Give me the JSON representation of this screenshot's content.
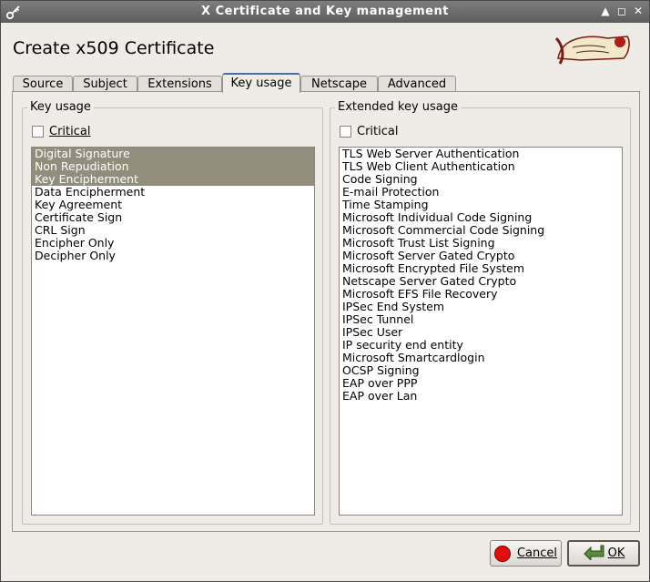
{
  "window": {
    "title": "X Certificate and Key management",
    "app_icon": "key-icon"
  },
  "page_title": "Create x509 Certificate",
  "tabs": [
    {
      "label": "Source"
    },
    {
      "label": "Subject"
    },
    {
      "label": "Extensions"
    },
    {
      "label": "Key usage",
      "active": true
    },
    {
      "label": "Netscape"
    },
    {
      "label": "Advanced"
    }
  ],
  "key_usage": {
    "title": "Key usage",
    "critical_label": "Critical",
    "critical_checked": false,
    "items": [
      {
        "label": "Digital Signature",
        "selected": true
      },
      {
        "label": "Non Repudiation",
        "selected": true
      },
      {
        "label": "Key Encipherment",
        "selected": true
      },
      {
        "label": "Data Encipherment",
        "selected": false
      },
      {
        "label": "Key Agreement",
        "selected": false
      },
      {
        "label": "Certificate Sign",
        "selected": false
      },
      {
        "label": "CRL Sign",
        "selected": false
      },
      {
        "label": "Encipher Only",
        "selected": false
      },
      {
        "label": "Decipher Only",
        "selected": false
      }
    ]
  },
  "extended_key_usage": {
    "title": "Extended key usage",
    "critical_label": "Critical",
    "critical_checked": false,
    "items": [
      "TLS Web Server Authentication",
      "TLS Web Client Authentication",
      "Code Signing",
      "E-mail Protection",
      "Time Stamping",
      "Microsoft Individual Code Signing",
      "Microsoft Commercial Code Signing",
      "Microsoft Trust List Signing",
      "Microsoft Server Gated Crypto",
      "Microsoft Encrypted File System",
      "Netscape Server Gated Crypto",
      "Microsoft EFS File Recovery",
      "IPSec End System",
      "IPSec Tunnel",
      "IPSec User",
      "IP security end entity",
      "Microsoft Smartcardlogin",
      "OCSP Signing",
      "EAP over PPP",
      "EAP over Lan"
    ]
  },
  "buttons": {
    "cancel_label": "Cancel",
    "ok_label": "OK"
  },
  "colors": {
    "selection": "#938d7b",
    "background": "#efebe7",
    "titlebar": "#6a6a6a"
  }
}
